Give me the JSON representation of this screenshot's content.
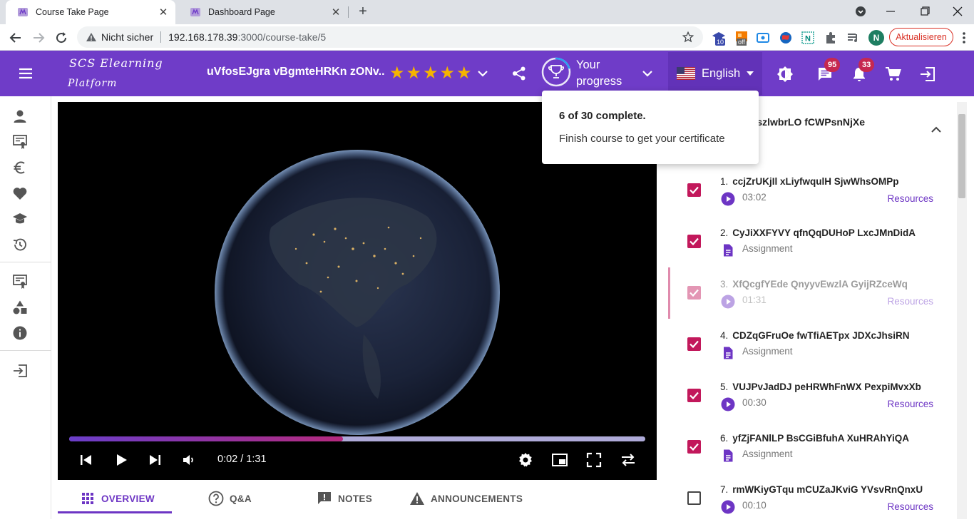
{
  "browser": {
    "tabs": [
      {
        "title": "Course Take Page",
        "active": true
      },
      {
        "title": "Dashboard Page",
        "active": false
      }
    ],
    "omnibox": {
      "security_label": "Nicht sicher",
      "url_host": "192.168.178.39",
      "url_path": ":3000/course-take/5"
    },
    "extensions": [
      {
        "icon": "graduation-ext-icon",
        "badge": "10"
      },
      {
        "icon": "orange-ext-icon",
        "badge": "off"
      },
      {
        "icon": "blue-square-ext-icon",
        "badge": ""
      },
      {
        "icon": "globe-ext-icon",
        "badge": ""
      },
      {
        "icon": "n-ext-icon",
        "badge": ""
      },
      {
        "icon": "puzzle-icon",
        "badge": ""
      },
      {
        "icon": "playlist-icon",
        "badge": ""
      }
    ],
    "profile_initial": "N",
    "update_label": "Aktualisieren"
  },
  "header": {
    "logo_line1": "SCS Elearning",
    "logo_line2": "Platform",
    "course_title": "uVfosEJgra vBgmteHRKn zONv...",
    "rating_stars": 5,
    "progress_label_line1": "Your",
    "progress_label_line2": "progress",
    "progress_fraction": 0.2,
    "language": "English",
    "messages_badge": "95",
    "notifications_badge": "33"
  },
  "popover": {
    "complete_text": "6 of 30 complete.",
    "hint_text": "Finish course to get your certificate"
  },
  "video": {
    "time": "0:02 / 1:31",
    "played_fraction": 0.022,
    "buffered_fraction": 0.475
  },
  "content_tabs": [
    {
      "label": "OVERVIEW",
      "icon": "grid-icon",
      "active": true
    },
    {
      "label": "Q&A",
      "icon": "help-circle-icon",
      "active": false
    },
    {
      "label": "NOTES",
      "icon": "note-icon",
      "active": false
    },
    {
      "label": "ANNOUNCEMENTS",
      "icon": "warning-icon",
      "active": false
    }
  ],
  "curriculum": {
    "section_title": "6niE zGszlwbrLO fCWPsnNjXe",
    "lessons": [
      {
        "num": "1.",
        "title": "ccjZrUKjIl xLiyfwqulH SjwWhsOMPp",
        "type": "video",
        "meta": "03:02",
        "resources": "Resources",
        "checked": true,
        "current": false
      },
      {
        "num": "2.",
        "title": "CyJiXXFYVY qfnQqDUHoP LxcJMnDidA",
        "type": "assignment",
        "meta": "Assignment",
        "resources": "",
        "checked": true,
        "current": false
      },
      {
        "num": "3.",
        "title": "XfQcgfYEde QnyyvEwzlA GyijRZceWq",
        "type": "video",
        "meta": "01:31",
        "resources": "Resources",
        "checked": true,
        "current": true
      },
      {
        "num": "4.",
        "title": "CDZqGFruOe fwTfiAETpx JDXcJhsiRN",
        "type": "assignment",
        "meta": "Assignment",
        "resources": "",
        "checked": true,
        "current": false
      },
      {
        "num": "5.",
        "title": "VUJPvJadDJ peHRWhFnWX PexpiMvxXb",
        "type": "video",
        "meta": "00:30",
        "resources": "Resources",
        "checked": true,
        "current": false
      },
      {
        "num": "6.",
        "title": "yfZjFANlLP BsCGiBfuhA XuHRAhYiQA",
        "type": "assignment",
        "meta": "Assignment",
        "resources": "",
        "checked": true,
        "current": false
      },
      {
        "num": "7.",
        "title": "rmWKiyGTqu mCUZaJKviG YVsvRnQnxU",
        "type": "video",
        "meta": "00:10",
        "resources": "Resources",
        "checked": false,
        "current": false
      }
    ]
  },
  "colors": {
    "brand": "#6f3cc8",
    "accent": "#c2185b",
    "link": "#6d35c4",
    "star": "#f5b400"
  }
}
